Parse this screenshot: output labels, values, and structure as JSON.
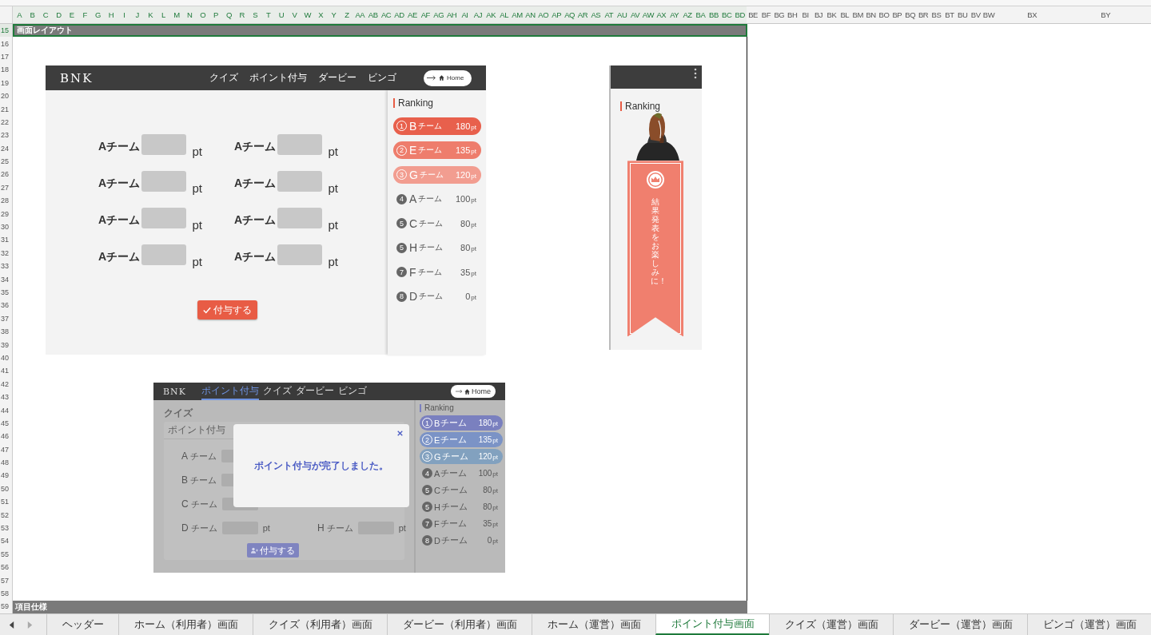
{
  "sheet": {
    "columns": [
      {
        "label": "A",
        "selected": true
      },
      {
        "label": "B",
        "selected": true
      },
      {
        "label": "C",
        "selected": true
      },
      {
        "label": "D",
        "selected": true
      },
      {
        "label": "E",
        "selected": true
      },
      {
        "label": "F",
        "selected": true
      },
      {
        "label": "G",
        "selected": true
      },
      {
        "label": "H",
        "selected": true
      },
      {
        "label": "I",
        "selected": true
      },
      {
        "label": "J",
        "selected": true
      },
      {
        "label": "K",
        "selected": true
      },
      {
        "label": "L",
        "selected": true
      },
      {
        "label": "M",
        "selected": true
      },
      {
        "label": "N",
        "selected": true
      },
      {
        "label": "O",
        "selected": true
      },
      {
        "label": "P",
        "selected": true
      },
      {
        "label": "Q",
        "selected": true
      },
      {
        "label": "R",
        "selected": true
      },
      {
        "label": "S",
        "selected": true
      },
      {
        "label": "T",
        "selected": true
      },
      {
        "label": "U",
        "selected": true
      },
      {
        "label": "V",
        "selected": true
      },
      {
        "label": "W",
        "selected": true
      },
      {
        "label": "X",
        "selected": true
      },
      {
        "label": "Y",
        "selected": true
      },
      {
        "label": "Z",
        "selected": true
      },
      {
        "label": "AA",
        "selected": true
      },
      {
        "label": "AB",
        "selected": true
      },
      {
        "label": "AC",
        "selected": true
      },
      {
        "label": "AD",
        "selected": true
      },
      {
        "label": "AE",
        "selected": true
      },
      {
        "label": "AF",
        "selected": true
      },
      {
        "label": "AG",
        "selected": true
      },
      {
        "label": "AH",
        "selected": true
      },
      {
        "label": "AI",
        "selected": true
      },
      {
        "label": "AJ",
        "selected": true
      },
      {
        "label": "AK",
        "selected": true
      },
      {
        "label": "AL",
        "selected": true
      },
      {
        "label": "AM",
        "selected": true
      },
      {
        "label": "AN",
        "selected": true
      },
      {
        "label": "AO",
        "selected": true
      },
      {
        "label": "AP",
        "selected": true
      },
      {
        "label": "AQ",
        "selected": true
      },
      {
        "label": "AR",
        "selected": true
      },
      {
        "label": "AS",
        "selected": true
      },
      {
        "label": "AT",
        "selected": true
      },
      {
        "label": "AU",
        "selected": true
      },
      {
        "label": "AV",
        "selected": true
      },
      {
        "label": "AW",
        "selected": true
      },
      {
        "label": "AX",
        "selected": true
      },
      {
        "label": "AY",
        "selected": true
      },
      {
        "label": "AZ",
        "selected": true
      },
      {
        "label": "BA",
        "selected": true
      },
      {
        "label": "BB",
        "selected": true
      },
      {
        "label": "BC",
        "selected": true
      },
      {
        "label": "BD",
        "selected": true
      },
      {
        "label": "BE",
        "selected": false
      },
      {
        "label": "BF",
        "selected": false
      },
      {
        "label": "BG",
        "selected": false
      },
      {
        "label": "BH",
        "selected": false
      },
      {
        "label": "BI",
        "selected": false
      },
      {
        "label": "BJ",
        "selected": false
      },
      {
        "label": "BK",
        "selected": false
      },
      {
        "label": "BL",
        "selected": false
      },
      {
        "label": "BM",
        "selected": false
      },
      {
        "label": "BN",
        "selected": false
      },
      {
        "label": "BO",
        "selected": false
      },
      {
        "label": "BP",
        "selected": false
      },
      {
        "label": "BQ",
        "selected": false
      },
      {
        "label": "BR",
        "selected": false
      },
      {
        "label": "BS",
        "selected": false
      },
      {
        "label": "BT",
        "selected": false
      },
      {
        "label": "BU",
        "selected": false
      },
      {
        "label": "BV",
        "selected": false
      },
      {
        "label": "BW",
        "selected": false
      },
      {
        "label": "BX",
        "selected": false
      },
      {
        "label": "BY",
        "selected": false
      }
    ],
    "rows": [
      {
        "label": "15",
        "selected": true
      },
      {
        "label": "16",
        "selected": false
      },
      {
        "label": "17",
        "selected": false
      },
      {
        "label": "18",
        "selected": false
      },
      {
        "label": "19",
        "selected": false
      },
      {
        "label": "20",
        "selected": false
      },
      {
        "label": "21",
        "selected": false
      },
      {
        "label": "22",
        "selected": false
      },
      {
        "label": "23",
        "selected": false
      },
      {
        "label": "24",
        "selected": false
      },
      {
        "label": "25",
        "selected": false
      },
      {
        "label": "26",
        "selected": false
      },
      {
        "label": "27",
        "selected": false
      },
      {
        "label": "28",
        "selected": false
      },
      {
        "label": "29",
        "selected": false
      },
      {
        "label": "30",
        "selected": false
      },
      {
        "label": "31",
        "selected": false
      },
      {
        "label": "32",
        "selected": false
      },
      {
        "label": "33",
        "selected": false
      },
      {
        "label": "34",
        "selected": false
      },
      {
        "label": "35",
        "selected": false
      },
      {
        "label": "36",
        "selected": false
      },
      {
        "label": "37",
        "selected": false
      },
      {
        "label": "38",
        "selected": false
      },
      {
        "label": "39",
        "selected": false
      },
      {
        "label": "40",
        "selected": false
      },
      {
        "label": "41",
        "selected": false
      },
      {
        "label": "42",
        "selected": false
      },
      {
        "label": "43",
        "selected": false
      },
      {
        "label": "44",
        "selected": false
      },
      {
        "label": "45",
        "selected": false
      },
      {
        "label": "46",
        "selected": false
      },
      {
        "label": "47",
        "selected": false
      },
      {
        "label": "48",
        "selected": false
      },
      {
        "label": "49",
        "selected": false
      },
      {
        "label": "50",
        "selected": false
      },
      {
        "label": "51",
        "selected": false
      },
      {
        "label": "52",
        "selected": false
      },
      {
        "label": "53",
        "selected": false
      },
      {
        "label": "54",
        "selected": false
      },
      {
        "label": "55",
        "selected": false
      },
      {
        "label": "56",
        "selected": false
      },
      {
        "label": "57",
        "selected": false
      },
      {
        "label": "58",
        "selected": false
      },
      {
        "label": "59",
        "selected": false
      }
    ],
    "section_title": "画面レイアウト",
    "footer_section_title": "項目仕様"
  },
  "pc_mockup": {
    "logo": "BNK",
    "nav": [
      "クイズ",
      "ポイント付与",
      "ダービー",
      "ビンゴ"
    ],
    "home_button": "Home",
    "form": [
      {
        "team": "Aチーム",
        "unit": "pt"
      },
      {
        "team": "Aチーム",
        "unit": "pt"
      },
      {
        "team": "Aチーム",
        "unit": "pt"
      },
      {
        "team": "Aチーム",
        "unit": "pt"
      },
      {
        "team": "Aチーム",
        "unit": "pt"
      },
      {
        "team": "Aチーム",
        "unit": "pt"
      },
      {
        "team": "Aチーム",
        "unit": "pt"
      },
      {
        "team": "Aチーム",
        "unit": "pt"
      }
    ],
    "submit_button": "付与する",
    "ranking_title": "Ranking",
    "ranking": [
      {
        "rank": "1",
        "team": "B",
        "suffix": "チーム",
        "score": "180",
        "unit": "pt",
        "color": "#e8604c"
      },
      {
        "rank": "2",
        "team": "E",
        "suffix": "チーム",
        "score": "135",
        "unit": "pt",
        "color": "#ee7d6c"
      },
      {
        "rank": "3",
        "team": "G",
        "suffix": "チーム",
        "score": "120",
        "unit": "pt",
        "color": "#f29d90"
      },
      {
        "rank": "4",
        "team": "A",
        "suffix": "チーム",
        "score": "100",
        "unit": "pt"
      },
      {
        "rank": "5",
        "team": "C",
        "suffix": "チーム",
        "score": "80",
        "unit": "pt"
      },
      {
        "rank": "5",
        "team": "H",
        "suffix": "チーム",
        "score": "80",
        "unit": "pt"
      },
      {
        "rank": "7",
        "team": "F",
        "suffix": "チーム",
        "score": "35",
        "unit": "pt"
      },
      {
        "rank": "8",
        "team": "D",
        "suffix": "チーム",
        "score": "0",
        "unit": "pt"
      }
    ]
  },
  "mobile_mockup": {
    "ranking_title": "Ranking",
    "banner_text": "結果発表をお楽しみに！"
  },
  "modal_mockup": {
    "logo": "BNK",
    "nav": [
      {
        "label": "ポイント付与",
        "selected": true
      },
      {
        "label": "クイズ",
        "selected": false
      },
      {
        "label": "ダービー",
        "selected": false
      },
      {
        "label": "ビンゴ",
        "selected": false
      }
    ],
    "home_button": "Home",
    "page_title": "クイズ",
    "card_title": "ポイント付与",
    "form": [
      {
        "team": "A",
        "suffix": "チーム"
      },
      {
        "team": "B",
        "suffix": "チーム"
      },
      {
        "team": "C",
        "suffix": "チーム"
      },
      {
        "team": "D",
        "suffix": "チーム",
        "unit": "pt"
      }
    ],
    "form_right": {
      "team": "H",
      "suffix": "チーム",
      "unit": "pt"
    },
    "submit_button": "付与する",
    "ranking_title": "Ranking",
    "ranking": [
      {
        "rank": "1",
        "team": "B",
        "suffix": "チーム",
        "score": "180",
        "unit": "pt",
        "color": "#7a80bf"
      },
      {
        "rank": "2",
        "team": "E",
        "suffix": "チーム",
        "score": "135",
        "unit": "pt",
        "color": "#7b93c6"
      },
      {
        "rank": "3",
        "team": "G",
        "suffix": "チーム",
        "score": "120",
        "unit": "pt",
        "color": "#82a1bf"
      },
      {
        "rank": "4",
        "team": "A",
        "suffix": "チーム",
        "score": "100",
        "unit": "pt"
      },
      {
        "rank": "5",
        "team": "C",
        "suffix": "チーム",
        "score": "80",
        "unit": "pt"
      },
      {
        "rank": "5",
        "team": "H",
        "suffix": "チーム",
        "score": "80",
        "unit": "pt"
      },
      {
        "rank": "7",
        "team": "F",
        "suffix": "チーム",
        "score": "35",
        "unit": "pt"
      },
      {
        "rank": "8",
        "team": "D",
        "suffix": "チーム",
        "score": "0",
        "unit": "pt"
      }
    ],
    "modal": {
      "message": "ポイント付与が完了しました。"
    }
  },
  "sheet_tabs": [
    {
      "label": "ヘッダー",
      "selected": false
    },
    {
      "label": "ホーム（利用者）画面",
      "selected": false
    },
    {
      "label": "クイズ（利用者）画面",
      "selected": false
    },
    {
      "label": "ダービー（利用者）画面",
      "selected": false
    },
    {
      "label": "ホーム（運営）画面",
      "selected": false
    },
    {
      "label": "ポイント付与画面",
      "selected": true
    },
    {
      "label": "クイズ（運営）画面",
      "selected": false
    },
    {
      "label": "ダービー（運営）画面",
      "selected": false
    },
    {
      "label": "ビンゴ（運営）画面",
      "selected": false
    }
  ]
}
